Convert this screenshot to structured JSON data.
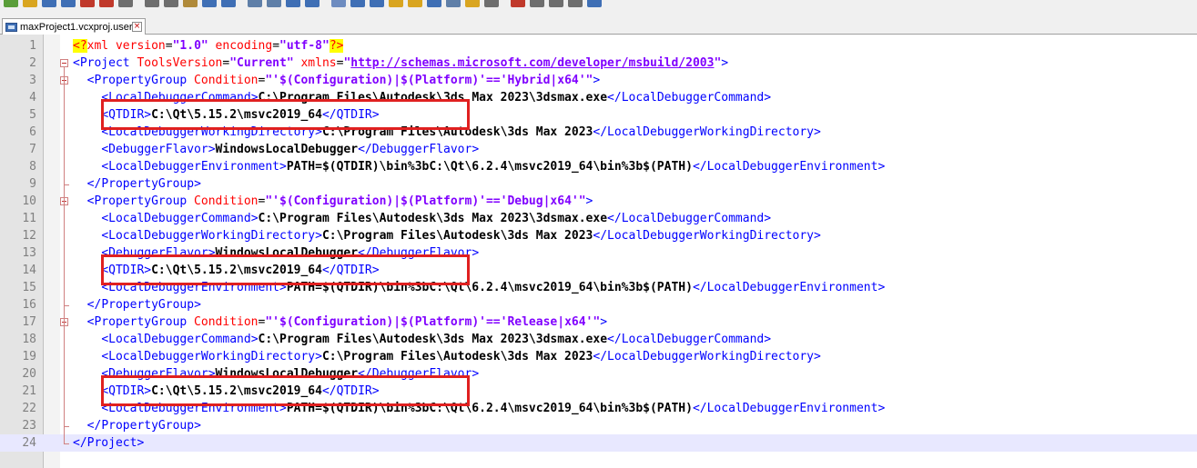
{
  "toolbar": {
    "icons": [
      "new-file-icon",
      "open-folder-icon",
      "save-icon",
      "save-all-icon",
      "close-file-icon",
      "close-all-icon",
      "print-icon",
      "cut-icon",
      "copy-icon",
      "paste-icon",
      "undo-icon",
      "redo-icon",
      "find-icon",
      "replace-icon",
      "zoom-in-icon",
      "zoom-out-icon",
      "sync-scroll-icon",
      "word-wrap-icon",
      "show-all-chars-icon",
      "indent-guide-icon",
      "user-language-icon",
      "doc-map-icon",
      "function-list-icon",
      "folder-workspace-icon",
      "monitoring-icon",
      "macro-record-icon",
      "macro-stop-icon",
      "macro-play-icon",
      "macro-run-multiple-icon",
      "macro-save-icon"
    ],
    "colors": [
      "#5a9e3a",
      "#d9a520",
      "#3f6fb5",
      "#3f6fb5",
      "#c0392b",
      "#c0392b",
      "#6e6e6e",
      "#6e6e6e",
      "#6e6e6e",
      "#b08a3a",
      "#3f6fb5",
      "#3f6fb5",
      "#5f7fa8",
      "#5f7fa8",
      "#3f6fb5",
      "#3f6fb5",
      "#6e8cc0",
      "#3f6fb5",
      "#3f6fb5",
      "#d9a520",
      "#d9a520",
      "#3f6fb5",
      "#5f7fa8",
      "#d9a520",
      "#6e6e6e",
      "#c0392b",
      "#6e6e6e",
      "#6e6e6e",
      "#6e6e6e",
      "#3f6fb5"
    ]
  },
  "tab": {
    "filename": "maxProject1.vcxproj.user",
    "close_glyph": "×"
  },
  "editor": {
    "lines": [
      {
        "n": "1",
        "tokens": [
          {
            "c": "t-decl-mark",
            "t": "<?"
          },
          {
            "c": "t-decl",
            "t": "xml"
          },
          {
            "c": "t-attr",
            "t": " version"
          },
          {
            "c": "t-eq",
            "t": "="
          },
          {
            "c": "t-val",
            "t": "\"1.0\""
          },
          {
            "c": "t-attr",
            "t": " encoding"
          },
          {
            "c": "t-eq",
            "t": "="
          },
          {
            "c": "t-val",
            "t": "\"utf-8\""
          },
          {
            "c": "t-decl-mark",
            "t": "?>"
          }
        ]
      },
      {
        "n": "2",
        "tokens": [
          {
            "c": "t-bracket",
            "t": "<"
          },
          {
            "c": "t-tag",
            "t": "Project"
          },
          {
            "c": "t-attr",
            "t": " ToolsVersion"
          },
          {
            "c": "t-eq",
            "t": "="
          },
          {
            "c": "t-val",
            "t": "\"Current\""
          },
          {
            "c": "t-attr",
            "t": " xmlns"
          },
          {
            "c": "t-eq",
            "t": "="
          },
          {
            "c": "t-val",
            "t": "\""
          },
          {
            "c": "t-url",
            "t": "http://schemas.microsoft.com/developer/msbuild/2003"
          },
          {
            "c": "t-val",
            "t": "\""
          },
          {
            "c": "t-bracket",
            "t": ">"
          }
        ]
      },
      {
        "n": "3",
        "tokens": [
          {
            "c": "t-text",
            "t": "  "
          },
          {
            "c": "t-bracket",
            "t": "<"
          },
          {
            "c": "t-tag",
            "t": "PropertyGroup"
          },
          {
            "c": "t-attr",
            "t": " Condition"
          },
          {
            "c": "t-eq",
            "t": "="
          },
          {
            "c": "t-val",
            "t": "\"'$(Configuration)|$(Platform)'=='Hybrid|x64'\""
          },
          {
            "c": "t-bracket",
            "t": ">"
          }
        ]
      },
      {
        "n": "4",
        "tokens": [
          {
            "c": "t-text",
            "t": "    "
          },
          {
            "c": "t-bracket",
            "t": "<"
          },
          {
            "c": "t-tag",
            "t": "LocalDebuggerCommand"
          },
          {
            "c": "t-bracket",
            "t": ">"
          },
          {
            "c": "t-text",
            "t": "C:\\Program Files\\Autodesk\\3ds Max 2023\\3dsmax.exe"
          },
          {
            "c": "t-bracket",
            "t": "</"
          },
          {
            "c": "t-tag",
            "t": "LocalDebuggerCommand"
          },
          {
            "c": "t-bracket",
            "t": ">"
          }
        ]
      },
      {
        "n": "5",
        "tokens": [
          {
            "c": "t-text",
            "t": "    "
          },
          {
            "c": "t-bracket",
            "t": "<"
          },
          {
            "c": "t-tag",
            "t": "QTDIR"
          },
          {
            "c": "t-bracket",
            "t": ">"
          },
          {
            "c": "t-text",
            "t": "C:\\Qt\\5.15.2\\msvc2019_64"
          },
          {
            "c": "t-bracket",
            "t": "</"
          },
          {
            "c": "t-tag",
            "t": "QTDIR"
          },
          {
            "c": "t-bracket",
            "t": ">"
          }
        ]
      },
      {
        "n": "6",
        "tokens": [
          {
            "c": "t-text",
            "t": "    "
          },
          {
            "c": "t-bracket",
            "t": "<"
          },
          {
            "c": "t-tag",
            "t": "LocalDebuggerWorkingDirectory"
          },
          {
            "c": "t-bracket",
            "t": ">"
          },
          {
            "c": "t-text",
            "t": "C:\\Program Files\\Autodesk\\3ds Max 2023"
          },
          {
            "c": "t-bracket",
            "t": "</"
          },
          {
            "c": "t-tag",
            "t": "LocalDebuggerWorkingDirectory"
          },
          {
            "c": "t-bracket",
            "t": ">"
          }
        ]
      },
      {
        "n": "7",
        "tokens": [
          {
            "c": "t-text",
            "t": "    "
          },
          {
            "c": "t-bracket",
            "t": "<"
          },
          {
            "c": "t-tag",
            "t": "DebuggerFlavor"
          },
          {
            "c": "t-bracket",
            "t": ">"
          },
          {
            "c": "t-text",
            "t": "WindowsLocalDebugger"
          },
          {
            "c": "t-bracket",
            "t": "</"
          },
          {
            "c": "t-tag",
            "t": "DebuggerFlavor"
          },
          {
            "c": "t-bracket",
            "t": ">"
          }
        ]
      },
      {
        "n": "8",
        "tokens": [
          {
            "c": "t-text",
            "t": "    "
          },
          {
            "c": "t-bracket",
            "t": "<"
          },
          {
            "c": "t-tag",
            "t": "LocalDebuggerEnvironment"
          },
          {
            "c": "t-bracket",
            "t": ">"
          },
          {
            "c": "t-text",
            "t": "PATH=$(QTDIR)\\bin%3bC:\\Qt\\6.2.4\\msvc2019_64\\bin%3b$(PATH)"
          },
          {
            "c": "t-bracket",
            "t": "</"
          },
          {
            "c": "t-tag",
            "t": "LocalDebuggerEnvironment"
          },
          {
            "c": "t-bracket",
            "t": ">"
          }
        ]
      },
      {
        "n": "9",
        "tokens": [
          {
            "c": "t-text",
            "t": "  "
          },
          {
            "c": "t-bracket",
            "t": "</"
          },
          {
            "c": "t-tag",
            "t": "PropertyGroup"
          },
          {
            "c": "t-bracket",
            "t": ">"
          }
        ]
      },
      {
        "n": "10",
        "tokens": [
          {
            "c": "t-text",
            "t": "  "
          },
          {
            "c": "t-bracket",
            "t": "<"
          },
          {
            "c": "t-tag",
            "t": "PropertyGroup"
          },
          {
            "c": "t-attr",
            "t": " Condition"
          },
          {
            "c": "t-eq",
            "t": "="
          },
          {
            "c": "t-val",
            "t": "\"'$(Configuration)|$(Platform)'=='Debug|x64'\""
          },
          {
            "c": "t-bracket",
            "t": ">"
          }
        ]
      },
      {
        "n": "11",
        "tokens": [
          {
            "c": "t-text",
            "t": "    "
          },
          {
            "c": "t-bracket",
            "t": "<"
          },
          {
            "c": "t-tag",
            "t": "LocalDebuggerCommand"
          },
          {
            "c": "t-bracket",
            "t": ">"
          },
          {
            "c": "t-text",
            "t": "C:\\Program Files\\Autodesk\\3ds Max 2023\\3dsmax.exe"
          },
          {
            "c": "t-bracket",
            "t": "</"
          },
          {
            "c": "t-tag",
            "t": "LocalDebuggerCommand"
          },
          {
            "c": "t-bracket",
            "t": ">"
          }
        ]
      },
      {
        "n": "12",
        "tokens": [
          {
            "c": "t-text",
            "t": "    "
          },
          {
            "c": "t-bracket",
            "t": "<"
          },
          {
            "c": "t-tag",
            "t": "LocalDebuggerWorkingDirectory"
          },
          {
            "c": "t-bracket",
            "t": ">"
          },
          {
            "c": "t-text",
            "t": "C:\\Program Files\\Autodesk\\3ds Max 2023"
          },
          {
            "c": "t-bracket",
            "t": "</"
          },
          {
            "c": "t-tag",
            "t": "LocalDebuggerWorkingDirectory"
          },
          {
            "c": "t-bracket",
            "t": ">"
          }
        ]
      },
      {
        "n": "13",
        "tokens": [
          {
            "c": "t-text",
            "t": "    "
          },
          {
            "c": "t-bracket",
            "t": "<"
          },
          {
            "c": "t-tag",
            "t": "DebuggerFlavor"
          },
          {
            "c": "t-bracket",
            "t": ">"
          },
          {
            "c": "t-text",
            "t": "WindowsLocalDebugger"
          },
          {
            "c": "t-bracket",
            "t": "</"
          },
          {
            "c": "t-tag",
            "t": "DebuggerFlavor"
          },
          {
            "c": "t-bracket",
            "t": ">"
          }
        ]
      },
      {
        "n": "14",
        "tokens": [
          {
            "c": "t-text",
            "t": "    "
          },
          {
            "c": "t-bracket",
            "t": "<"
          },
          {
            "c": "t-tag",
            "t": "QTDIR"
          },
          {
            "c": "t-bracket",
            "t": ">"
          },
          {
            "c": "t-text",
            "t": "C:\\Qt\\5.15.2\\msvc2019_64"
          },
          {
            "c": "t-bracket",
            "t": "</"
          },
          {
            "c": "t-tag",
            "t": "QTDIR"
          },
          {
            "c": "t-bracket",
            "t": ">"
          }
        ]
      },
      {
        "n": "15",
        "tokens": [
          {
            "c": "t-text",
            "t": "    "
          },
          {
            "c": "t-bracket",
            "t": "<"
          },
          {
            "c": "t-tag",
            "t": "LocalDebuggerEnvironment"
          },
          {
            "c": "t-bracket",
            "t": ">"
          },
          {
            "c": "t-text",
            "t": "PATH=$(QTDIR)\\bin%3bC:\\Qt\\6.2.4\\msvc2019_64\\bin%3b$(PATH)"
          },
          {
            "c": "t-bracket",
            "t": "</"
          },
          {
            "c": "t-tag",
            "t": "LocalDebuggerEnvironment"
          },
          {
            "c": "t-bracket",
            "t": ">"
          }
        ]
      },
      {
        "n": "16",
        "tokens": [
          {
            "c": "t-text",
            "t": "  "
          },
          {
            "c": "t-bracket",
            "t": "</"
          },
          {
            "c": "t-tag",
            "t": "PropertyGroup"
          },
          {
            "c": "t-bracket",
            "t": ">"
          }
        ]
      },
      {
        "n": "17",
        "tokens": [
          {
            "c": "t-text",
            "t": "  "
          },
          {
            "c": "t-bracket",
            "t": "<"
          },
          {
            "c": "t-tag",
            "t": "PropertyGroup"
          },
          {
            "c": "t-attr",
            "t": " Condition"
          },
          {
            "c": "t-eq",
            "t": "="
          },
          {
            "c": "t-val",
            "t": "\"'$(Configuration)|$(Platform)'=='Release|x64'\""
          },
          {
            "c": "t-bracket",
            "t": ">"
          }
        ]
      },
      {
        "n": "18",
        "tokens": [
          {
            "c": "t-text",
            "t": "    "
          },
          {
            "c": "t-bracket",
            "t": "<"
          },
          {
            "c": "t-tag",
            "t": "LocalDebuggerCommand"
          },
          {
            "c": "t-bracket",
            "t": ">"
          },
          {
            "c": "t-text",
            "t": "C:\\Program Files\\Autodesk\\3ds Max 2023\\3dsmax.exe"
          },
          {
            "c": "t-bracket",
            "t": "</"
          },
          {
            "c": "t-tag",
            "t": "LocalDebuggerCommand"
          },
          {
            "c": "t-bracket",
            "t": ">"
          }
        ]
      },
      {
        "n": "19",
        "tokens": [
          {
            "c": "t-text",
            "t": "    "
          },
          {
            "c": "t-bracket",
            "t": "<"
          },
          {
            "c": "t-tag",
            "t": "LocalDebuggerWorkingDirectory"
          },
          {
            "c": "t-bracket",
            "t": ">"
          },
          {
            "c": "t-text",
            "t": "C:\\Program Files\\Autodesk\\3ds Max 2023"
          },
          {
            "c": "t-bracket",
            "t": "</"
          },
          {
            "c": "t-tag",
            "t": "LocalDebuggerWorkingDirectory"
          },
          {
            "c": "t-bracket",
            "t": ">"
          }
        ]
      },
      {
        "n": "20",
        "tokens": [
          {
            "c": "t-text",
            "t": "    "
          },
          {
            "c": "t-bracket",
            "t": "<"
          },
          {
            "c": "t-tag",
            "t": "DebuggerFlavor"
          },
          {
            "c": "t-bracket",
            "t": ">"
          },
          {
            "c": "t-text",
            "t": "WindowsLocalDebugger"
          },
          {
            "c": "t-bracket",
            "t": "</"
          },
          {
            "c": "t-tag",
            "t": "DebuggerFlavor"
          },
          {
            "c": "t-bracket",
            "t": ">"
          }
        ]
      },
      {
        "n": "21",
        "tokens": [
          {
            "c": "t-text",
            "t": "    "
          },
          {
            "c": "t-bracket",
            "t": "<"
          },
          {
            "c": "t-tag",
            "t": "QTDIR"
          },
          {
            "c": "t-bracket",
            "t": ">"
          },
          {
            "c": "t-text",
            "t": "C:\\Qt\\5.15.2\\msvc2019_64"
          },
          {
            "c": "t-bracket",
            "t": "</"
          },
          {
            "c": "t-tag",
            "t": "QTDIR"
          },
          {
            "c": "t-bracket",
            "t": ">"
          }
        ]
      },
      {
        "n": "22",
        "tokens": [
          {
            "c": "t-text",
            "t": "    "
          },
          {
            "c": "t-bracket",
            "t": "<"
          },
          {
            "c": "t-tag",
            "t": "LocalDebuggerEnvironment"
          },
          {
            "c": "t-bracket",
            "t": ">"
          },
          {
            "c": "t-text",
            "t": "PATH=$(QTDIR)\\bin%3bC:\\Qt\\6.2.4\\msvc2019_64\\bin%3b$(PATH)"
          },
          {
            "c": "t-bracket",
            "t": "</"
          },
          {
            "c": "t-tag",
            "t": "LocalDebuggerEnvironment"
          },
          {
            "c": "t-bracket",
            "t": ">"
          }
        ]
      },
      {
        "n": "23",
        "tokens": [
          {
            "c": "t-text",
            "t": "  "
          },
          {
            "c": "t-bracket",
            "t": "</"
          },
          {
            "c": "t-tag",
            "t": "PropertyGroup"
          },
          {
            "c": "t-bracket",
            "t": ">"
          }
        ]
      },
      {
        "n": "24",
        "tokens": [
          {
            "c": "t-bracket",
            "t": "</"
          },
          {
            "c": "t-tag",
            "t": "Project"
          },
          {
            "c": "t-bracket",
            "t": ">"
          }
        ]
      }
    ],
    "current_line": "24",
    "annotation_color": "#e02020"
  }
}
